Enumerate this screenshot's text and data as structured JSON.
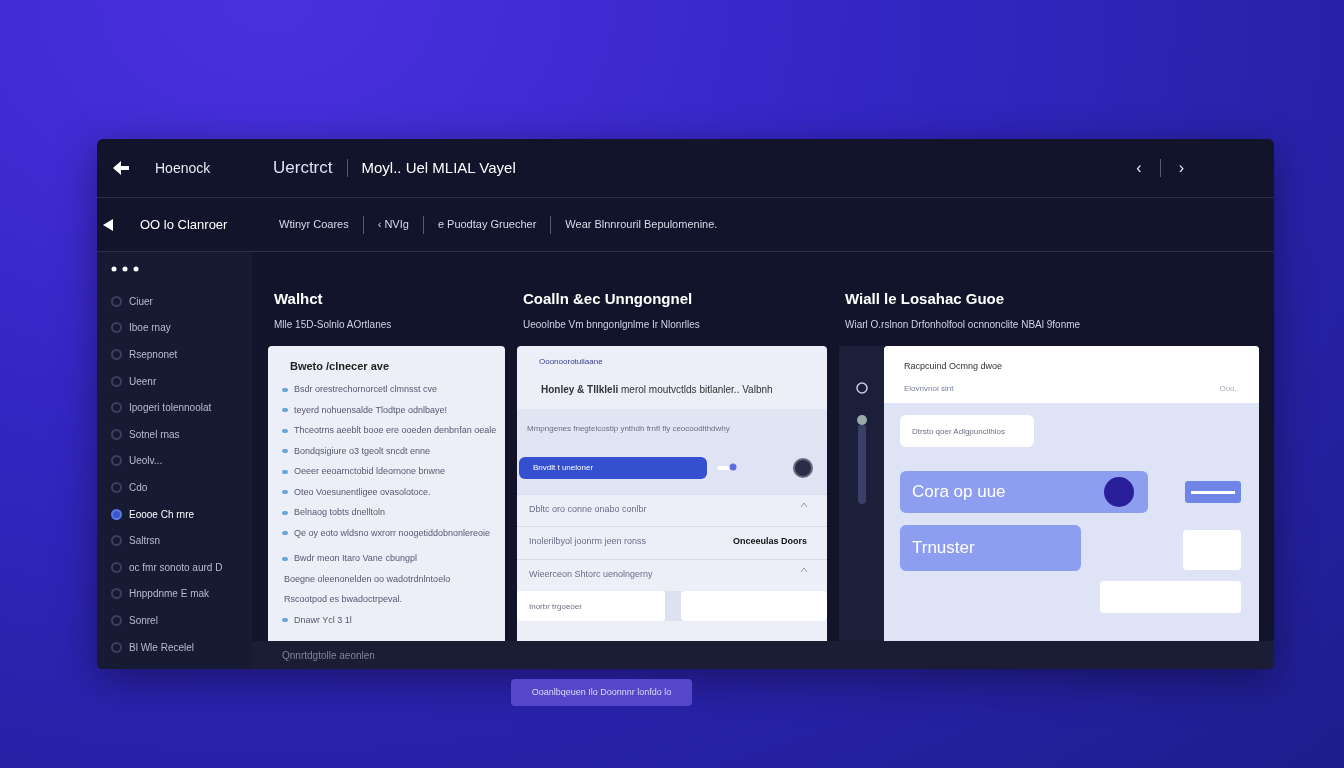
{
  "header": {
    "brand": "Hoenock",
    "title": "Uerctrct",
    "subtitle": "Moyl.. Uel MLIAL Vayel",
    "nav": [
      "‹",
      "›"
    ]
  },
  "subnav": {
    "title": "OO lo Clanroer",
    "items": [
      "Wtinyr Coares",
      "‹ NVIg",
      "e Puodtay Gruecher",
      "Wear Blnnrouril Bepulomenine."
    ]
  },
  "sidebar": {
    "items": [
      {
        "label": "Ciuer",
        "selected": false
      },
      {
        "label": "Iboe rnay",
        "selected": false
      },
      {
        "label": "Rsepnonet",
        "selected": false
      },
      {
        "label": "Ueenr",
        "selected": false
      },
      {
        "label": "Ipogeri tolennoolat",
        "selected": false
      },
      {
        "label": "Sotnel rnas",
        "selected": false
      },
      {
        "label": "Ueolv...",
        "selected": false
      },
      {
        "label": "Cdo",
        "selected": false
      },
      {
        "label": "Eoooe Ch rnre",
        "selected": true
      },
      {
        "label": "Saltrsn",
        "selected": false
      },
      {
        "label": "oc fmr sonoto aurd D",
        "selected": false
      },
      {
        "label": "Hnppdnme E mak",
        "selected": false
      },
      {
        "label": "Sonrel",
        "selected": false
      },
      {
        "label": "Bl Wle Recelel",
        "selected": false
      }
    ]
  },
  "panels": [
    {
      "kind": "checklist",
      "title": "Walhct",
      "subtitle": "Mlle 15D-Solnlo AOrtlanes",
      "card_title": "Bweto /clnecer ave",
      "items": [
        {
          "text": "Bsdr orestrechornorcetl clmnsst cve",
          "bullet": true
        },
        {
          "text": "teyerd nohuensalde Tlodtpe odnlbaye!",
          "bullet": true
        },
        {
          "text": "Thceotrns aeeblt booe ere ooeden denbnfan oeale",
          "bullet": true
        },
        {
          "text": "Bondqsigiure o3 tgeolt sncdt enne",
          "bullet": true
        },
        {
          "text": "Oeeer eeoarnctobid ldeornone bnwne",
          "bullet": true
        },
        {
          "text": "Oteo Voesunentligee ovasolotoce.",
          "bullet": true
        },
        {
          "text": "Belnaog tobts dnelltoln",
          "bullet": true
        },
        {
          "text": "Qe oy eoto wldsno wxrorr noogetiddobnonlereoie",
          "bullet": true
        },
        {
          "text": "Bwdr meon Itaro Vane cbungpl",
          "bullet": true
        },
        {
          "text": "Boegne oleenonelden oo wadotrdnlntoelo",
          "bullet": false
        },
        {
          "text": "Rscootpod es bwadoctrpeval.",
          "bullet": false
        },
        {
          "text": "Dnawr Ycl 3 1l",
          "bullet": true
        }
      ]
    },
    {
      "kind": "settings",
      "title": "Coalln &ec Unngongnel",
      "subtitle": "Ueoolnbe Vm bnngonlgnlme Ir Nlonrlles",
      "link": "Ooonoorotuliaane",
      "headline": "**Honley & Tllkleli** merol moutvctlds bitlanler.. Valbnh",
      "note": "Mmpngenes fnegtelcostip ynthdh frnfl fly ceocoodlthdwhy",
      "button": "Bnvdlt t uneloner",
      "toggle_on": true,
      "rows": [
        {
          "label": "Dbltc oro conne onabo conlbr",
          "value": ""
        },
        {
          "label": "Inolerilbyol joonrm jeen ronss",
          "value": "Onceeulas Doors"
        },
        {
          "label": "Wieerceon Shtorc uenolngerny",
          "value": ""
        }
      ],
      "field": {
        "placeholder": "Inorbr trgoeoer"
      }
    },
    {
      "kind": "guide",
      "title": "Wiall le Losahac Guoe",
      "subtitle": "Wiarl O.rslnon Drfonholfool ocnnonclite NBAl 9fonme",
      "card_title": "Racpcuind Ocmng dwoe",
      "card_sub": "Elovnvnoi slnt",
      "card_link": "Ooo..",
      "search": {
        "placeholder": "Dtrsto qoer Adlgpuncllhlos"
      },
      "tiles": [
        "Cora op uue",
        "Trnuster"
      ]
    }
  ],
  "footer": [
    "Qnnrtdgtolle aeonlen"
  ],
  "bottom_button": "Ooanlbqeuen Ilo Doonnnr lonfdo lo"
}
